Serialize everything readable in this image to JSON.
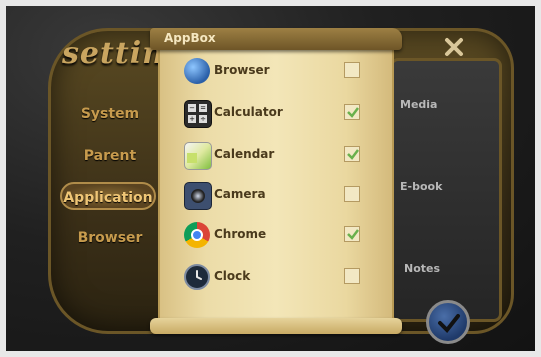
{
  "background": {
    "title": "setting",
    "menu": [
      {
        "label": "System"
      },
      {
        "label": "Parent"
      },
      {
        "label": "Application"
      },
      {
        "label": "Browser"
      }
    ],
    "right_labels": [
      {
        "label": "Media"
      },
      {
        "label": "E-book"
      },
      {
        "label": "Notes"
      }
    ]
  },
  "dialog": {
    "title": "AppBox",
    "apps": [
      {
        "label": "Browser",
        "icon": "globe-icon",
        "checked": false
      },
      {
        "label": "Calculator",
        "icon": "calculator-icon",
        "checked": true
      },
      {
        "label": "Calendar",
        "icon": "calendar-icon",
        "checked": true
      },
      {
        "label": "Camera",
        "icon": "camera-icon",
        "checked": false
      },
      {
        "label": "Chrome",
        "icon": "chrome-icon",
        "checked": true
      },
      {
        "label": "Clock",
        "icon": "clock-icon",
        "checked": false
      }
    ]
  },
  "colors": {
    "scroll": "#f3e6b8",
    "board": "#3c3018",
    "check": "#6ab04c"
  }
}
